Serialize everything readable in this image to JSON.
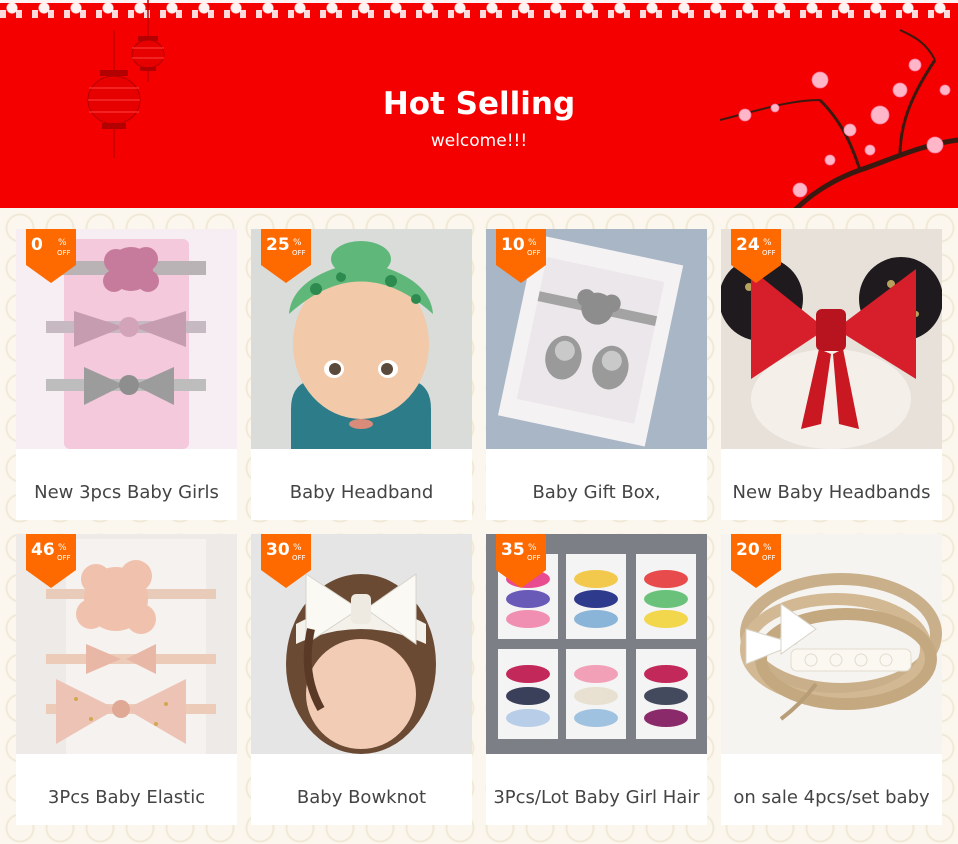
{
  "banner": {
    "title": "Hot Selling",
    "subtitle": "welcome!!!",
    "background_color": "#f40000"
  },
  "badge_color": "#ff6a00",
  "badge": {
    "percent_symbol": "%",
    "off_label": "OFF"
  },
  "products": [
    {
      "discount": "0",
      "title": "New 3pcs Baby Girls",
      "image": "pink-headband-set"
    },
    {
      "discount": "25",
      "title": "Baby Headband",
      "image": "baby-floral-headband"
    },
    {
      "discount": "10",
      "title": "Baby Gift Box,",
      "image": "gift-box-set"
    },
    {
      "discount": "24",
      "title": "New Baby Headbands",
      "image": "red-bow-sequin-ears"
    },
    {
      "discount": "46",
      "title": "3Pcs Baby Elastic",
      "image": "peach-flower-bows"
    },
    {
      "discount": "30",
      "title": "Baby Bowknot",
      "image": "white-bow-headband"
    },
    {
      "discount": "35",
      "title": "3Pcs/Lot Baby Girl Hair",
      "image": "headband-packs"
    },
    {
      "discount": "20",
      "title": "on sale 4pcs/set baby",
      "image": "nylon-lace-bands"
    }
  ]
}
